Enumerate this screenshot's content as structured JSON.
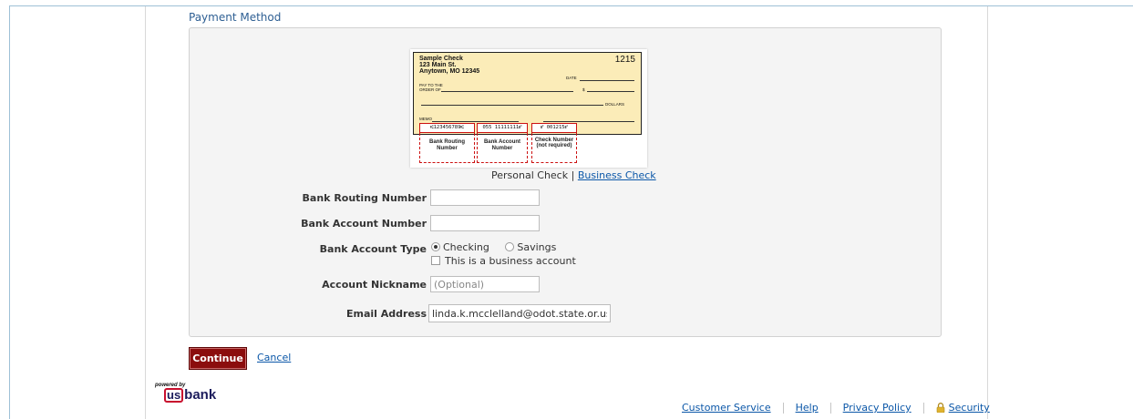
{
  "section": {
    "title": "Payment Method"
  },
  "check_image": {
    "name_line1": "Sample Check",
    "name_line2": "123 Main St.",
    "name_line3": "Anytown, MO 12345",
    "number": "1215",
    "date_label": "DATE",
    "pay_to_line1": "PAY TO THE",
    "pay_to_line2": "ORDER OF",
    "dollar_sign": "$",
    "dollars_label": "DOLLARS",
    "memo_label": "MEMO",
    "micr_routing": "⑆123456789⑆",
    "micr_account": "055 11111111⑈",
    "micr_check": "⑈ 001215⑈",
    "routing_caption": "Bank Routing Number",
    "account_caption": "Bank Account Number",
    "check_caption_1": "Check Number",
    "check_caption_2": "(not required)"
  },
  "check_type": {
    "personal": "Personal Check",
    "separator": "|",
    "business_link": "Business Check"
  },
  "form": {
    "routing_label": "Bank Routing Number",
    "routing_value": "",
    "account_label": "Bank Account Number",
    "account_value": "",
    "type_label": "Bank Account Type",
    "type_options": [
      "Checking",
      "Savings"
    ],
    "type_selected": "Checking",
    "business_checkbox_label": "This is a business account",
    "business_checked": false,
    "nickname_label": "Account Nickname",
    "nickname_placeholder": "(Optional)",
    "email_label": "Email Address",
    "email_value": "linda.k.mcclelland@odot.state.or.us"
  },
  "actions": {
    "continue_label": "Continue",
    "cancel_label": "Cancel"
  },
  "footer": {
    "powered_by": "powered by",
    "brand_us": "us",
    "brand_bank": "bank",
    "links": [
      "Customer Service",
      "Help",
      "Privacy Policy",
      "Security"
    ]
  },
  "colors": {
    "accent": "#8b0d0d",
    "link": "#0b57a8",
    "title": "#2e5f93",
    "check_bg": "#fbecb8"
  }
}
